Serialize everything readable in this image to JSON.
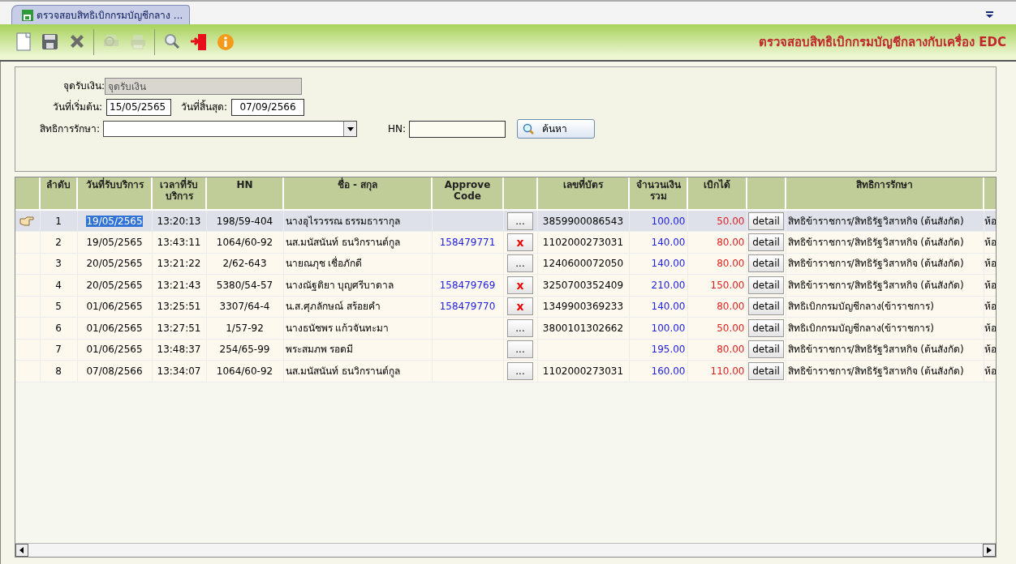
{
  "tab": {
    "title": "ตรวจสอบสิทธิเบิกกรมบัญชีกลาง ...",
    "selected": true
  },
  "toolbar": {
    "tools": [
      {
        "kind": "new",
        "disabled": false
      },
      {
        "kind": "save",
        "disabled": false
      },
      {
        "kind": "delete",
        "disabled": false
      },
      {
        "kind": "separator"
      },
      {
        "kind": "preview",
        "disabled": true
      },
      {
        "kind": "print",
        "disabled": true
      },
      {
        "kind": "separator"
      },
      {
        "kind": "search",
        "disabled": false
      },
      {
        "kind": "exit",
        "disabled": false
      },
      {
        "kind": "info",
        "disabled": false
      }
    ],
    "title": "ตรวจสอบสิทธิเบิกกรมบัญชีกลางกับเครื่อง EDC"
  },
  "form": {
    "payment_point": {
      "label": "จุดรับเงิน:",
      "value": "จุดรับเงิน",
      "disabled": true
    },
    "start_date": {
      "label": "วันที่เริ่มต้น:",
      "value": "15/05/2565"
    },
    "end_date": {
      "label": "วันที่สิ้นสุด:",
      "value": "07/09/2566"
    },
    "rights": {
      "label": "สิทธิการรักษา:"
    },
    "hn": {
      "label": "HN:"
    },
    "search_button": "ค้นหา"
  },
  "table": {
    "columns": [
      {
        "kind": "indicator"
      },
      {
        "kind": "no",
        "lines": [
          "ลำดับ"
        ]
      },
      {
        "kind": "date",
        "lines": [
          "วันที่รับบริการ"
        ]
      },
      {
        "kind": "time",
        "lines": [
          "เวลาที่รับ",
          "บริการ"
        ]
      },
      {
        "kind": "hn",
        "lines": [
          "HN"
        ]
      },
      {
        "kind": "name",
        "lines": [
          "ชื่อ - สกุล"
        ]
      },
      {
        "kind": "approve_code",
        "lines": [
          "Approve",
          "Code"
        ]
      },
      {
        "kind": "action"
      },
      {
        "kind": "card_no",
        "lines": [
          "เลขที่บัตร"
        ]
      },
      {
        "kind": "amount",
        "lines": [
          "จำนวนเงิน",
          "รวม"
        ]
      },
      {
        "kind": "claim",
        "lines": [
          "เบิกได้"
        ]
      },
      {
        "kind": "detail"
      },
      {
        "kind": "rights",
        "lines": [
          "สิทธิการรักษา"
        ]
      },
      {
        "kind": "column_14"
      }
    ],
    "rows": [
      {
        "selected": true,
        "no": "1",
        "date": "19/05/2565",
        "time": "13:20:13",
        "hn": "198/59-404",
        "name": "นางอุไรวรรณ ธรรมธารากุล",
        "action": {
          "kind": "more",
          "label": "..."
        },
        "card_no": "3859900086543",
        "amount": "100.00",
        "claim": "50.00",
        "detail": "detail",
        "rights": "สิทธิข้าราชการ/สิทธิรัฐวิสาหกิจ (ต้นสังกัด)",
        "column_14": "ห้อ"
      },
      {
        "selected": false,
        "no": "2",
        "date": "19/05/2565",
        "time": "13:43:11",
        "hn": "1064/60-92",
        "name": "นส.มนัสนันท์ ธนวิกรานต์กูล",
        "approve_code": "158479771",
        "action": {
          "kind": "cancel",
          "label": "x"
        },
        "card_no": "1102000273031",
        "amount": "140.00",
        "claim": "80.00",
        "detail": "detail",
        "rights": "สิทธิข้าราชการ/สิทธิรัฐวิสาหกิจ (ต้นสังกัด)",
        "column_14": "ห้อ"
      },
      {
        "selected": false,
        "no": "3",
        "date": "20/05/2565",
        "time": "13:21:22",
        "hn": "2/62-643",
        "name": "นายณภุช เชื่อภักดี",
        "action": {
          "kind": "more",
          "label": "..."
        },
        "card_no": "1240600072050",
        "amount": "140.00",
        "claim": "80.00",
        "detail": "detail",
        "rights": "สิทธิข้าราชการ/สิทธิรัฐวิสาหกิจ (ต้นสังกัด)",
        "column_14": "ห้อ"
      },
      {
        "selected": false,
        "no": "4",
        "date": "20/05/2565",
        "time": "13:21:43",
        "hn": "5380/54-57",
        "name": "นางณัฐติยา บุญศรีบาดาล",
        "approve_code": "158479769",
        "action": {
          "kind": "cancel",
          "label": "x"
        },
        "card_no": "3250700352409",
        "amount": "210.00",
        "claim": "150.00",
        "detail": "detail",
        "rights": "สิทธิข้าราชการ/สิทธิรัฐวิสาหกิจ (ต้นสังกัด)",
        "column_14": "ห้อ"
      },
      {
        "selected": false,
        "no": "5",
        "date": "01/06/2565",
        "time": "13:25:51",
        "hn": "3307/64-4",
        "name": "น.ส.ศุภลักษณ์ สร้อยคำ",
        "approve_code": "158479770",
        "action": {
          "kind": "cancel",
          "label": "x"
        },
        "card_no": "1349900369233",
        "amount": "140.00",
        "claim": "80.00",
        "detail": "detail",
        "rights": "สิทธิเบิกกรมบัญชีกลาง(ข้าราชการ)",
        "column_14": "ห้อ"
      },
      {
        "selected": false,
        "no": "6",
        "date": "01/06/2565",
        "time": "13:27:51",
        "hn": "1/57-92",
        "name": "นางธนัชพร แก้วจันทะมา",
        "action": {
          "kind": "more",
          "label": "..."
        },
        "card_no": "3800101302662",
        "amount": "100.00",
        "claim": "50.00",
        "detail": "detail",
        "rights": "สิทธิเบิกกรมบัญชีกลาง(ข้าราชการ)",
        "column_14": "ห้อ"
      },
      {
        "selected": false,
        "no": "7",
        "date": "01/06/2565",
        "time": "13:48:37",
        "hn": "254/65-99",
        "name": "พระสมภพ รอดมี",
        "action": {
          "kind": "more",
          "label": "..."
        },
        "amount": "195.00",
        "claim": "80.00",
        "detail": "detail",
        "rights": "สิทธิข้าราชการ/สิทธิรัฐวิสาหกิจ (ต้นสังกัด)",
        "column_14": "ห้อ"
      },
      {
        "selected": false,
        "no": "8",
        "date": "07/08/2566",
        "time": "13:34:07",
        "hn": "1064/60-92",
        "name": "นส.มนัสนันท์ ธนวิกรานต์กูล",
        "action": {
          "kind": "more",
          "label": "..."
        },
        "card_no": "1102000273031",
        "amount": "160.00",
        "claim": "110.00",
        "detail": "detail",
        "rights": "สิทธิข้าราชการ/สิทธิรัฐวิสาหกิจ (ต้นสังกัด)",
        "column_14": "ห้อ"
      }
    ]
  }
}
